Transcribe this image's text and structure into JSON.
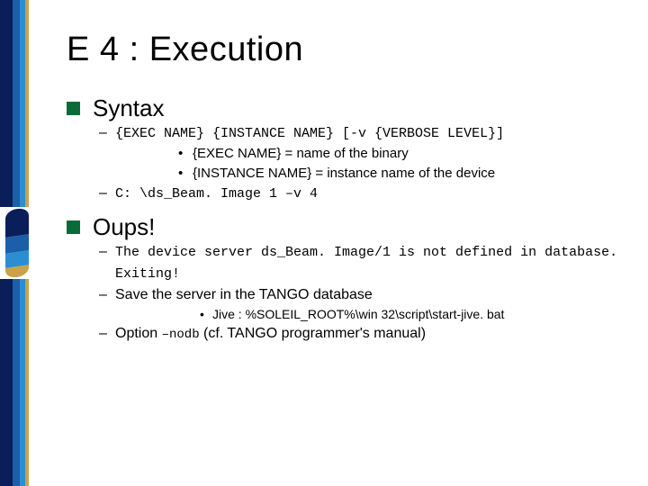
{
  "title": "E 4 : Execution",
  "sections": [
    {
      "heading": "Syntax",
      "items": [
        {
          "text_mono": "{EXEC NAME} {INSTANCE NAME} [-v {VERBOSE LEVEL}]",
          "sub": [
            {
              "text": "{EXEC NAME} = name of the binary"
            },
            {
              "text": "{INSTANCE NAME} = instance name of the device"
            }
          ]
        },
        {
          "text_mono": "C: \\ds_Beam. Image 1 –v 4"
        }
      ]
    },
    {
      "heading": "Oups!",
      "items": [
        {
          "text_mono": "The device server ds_Beam. Image/1 is not defined in database. Exiting!"
        },
        {
          "text": "Save the server in the TANGO database",
          "sub3": [
            {
              "text": "Jive : %SOLEIL_ROOT%\\win 32\\script\\start-jive. bat"
            }
          ]
        },
        {
          "prefix": "Option ",
          "mono_inline": "–nodb",
          "suffix": " (cf. TANGO programmer's manual)"
        }
      ]
    }
  ]
}
